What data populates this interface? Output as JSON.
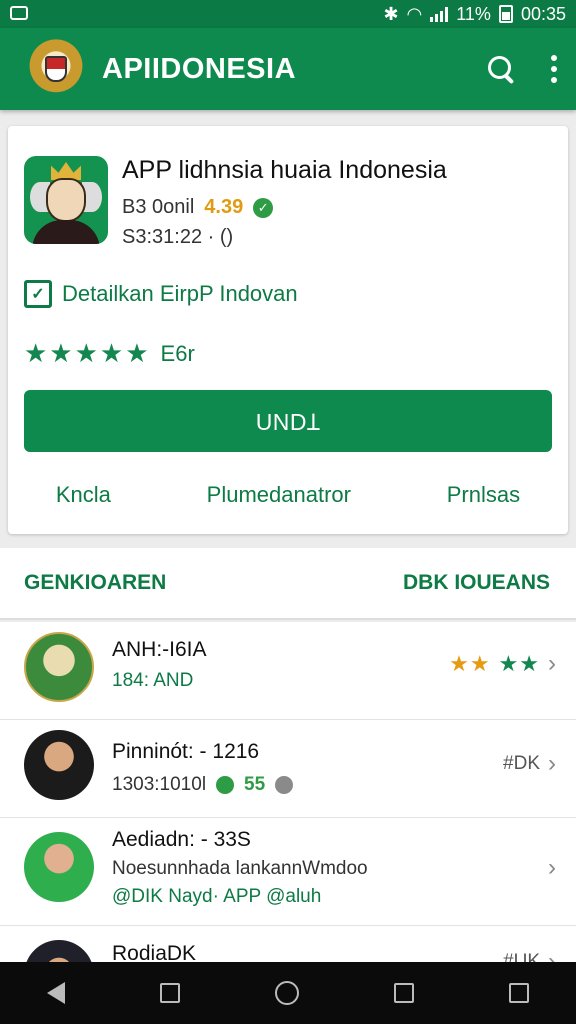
{
  "status_bar": {
    "notification_icon": "notification-box-icon",
    "battery_percent": "11%",
    "time": "00:35"
  },
  "app_bar": {
    "title": "APIIDONESIA"
  },
  "app_card": {
    "name": "APP lidhnsia huaia Indonesia",
    "meta1_text": "B3 0onil",
    "rating": "4.39",
    "meta2_text": "S3:31:22 · ()",
    "detail_text": "Detailkan EirpP Indovan",
    "stars": "★★★★★",
    "stars_label": "E6r",
    "install_label": "UNDꞱ",
    "links": [
      "Kncla",
      "Plumedanatror",
      "Prnlsas"
    ]
  },
  "section": {
    "left_label": "GENKIOAREN",
    "right_label": "DBK IOUEANS"
  },
  "list": [
    {
      "title": "ANH:-I6IA",
      "subtitle": "184: AND",
      "stars_orange": "★★",
      "stars_green": "★★"
    },
    {
      "title": "Pinninót: - 1216",
      "subtitle": "1303:1010l",
      "count": "55",
      "right_text": "#DK"
    },
    {
      "title": "Aediadn: - 33S",
      "subtitle": "Noesunnhada lankannWmdoo",
      "subtitle2": "@DIK Nayd· APP @aluh"
    },
    {
      "title": "RodiaDK",
      "right_text": "#UK"
    }
  ]
}
